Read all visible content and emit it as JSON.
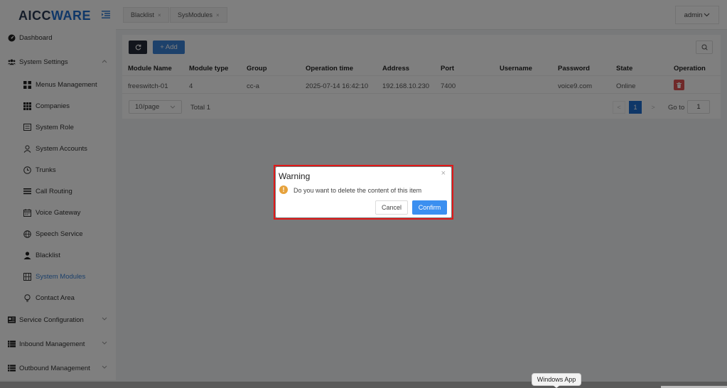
{
  "brand": {
    "logo_part1": "AICC",
    "logo_part2": "WARE"
  },
  "sidebar": {
    "dashboard": "Dashboard",
    "system_settings": "System Settings",
    "sub_items": [
      "Menus Management",
      "Companies",
      "System Role",
      "System Accounts",
      "Trunks",
      "Call Routing",
      "Voice Gateway",
      "Speech Service",
      "Blacklist",
      "System Modules",
      "Contact Area"
    ],
    "active_item": "System Modules",
    "service_configuration": "Service Configuration",
    "inbound_management": "Inbound Management",
    "outbound_management": "Outbound Management"
  },
  "header": {
    "tabs": [
      {
        "label": "Blacklist",
        "close": "×"
      },
      {
        "label": "SysModules",
        "close": "×"
      }
    ],
    "user": "admin"
  },
  "toolbar": {
    "add_label": "+ Add"
  },
  "table": {
    "columns": [
      "Module Name",
      "Module type",
      "Group",
      "Operation time",
      "Address",
      "Port",
      "Username",
      "Password",
      "State",
      "Operation"
    ],
    "rows": [
      [
        "freeswitch-01",
        "4",
        "cc-a",
        "2025-07-14 16:42:10",
        "192.168.10.230",
        "7400",
        "",
        "voice9.com",
        "Online",
        ""
      ]
    ]
  },
  "pagination": {
    "page_size": "10/page",
    "total": "Total 1",
    "prev": "<",
    "current": "1",
    "next": ">",
    "goto_label": "Go to",
    "goto_value": "1"
  },
  "dialog": {
    "title": "Warning",
    "close": "×",
    "icon": "!",
    "message": "Do you want to delete the content of this item",
    "cancel": "Cancel",
    "confirm": "Confirm"
  },
  "taskbar": {
    "tooltip": "Windows App"
  },
  "colors": {
    "primary": "#3b82d6",
    "danger": "#e05252",
    "warning": "#e6a23c",
    "highlight_frame": "#e01818"
  }
}
